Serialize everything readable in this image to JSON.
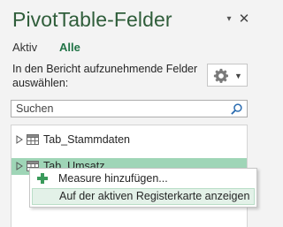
{
  "pane": {
    "title": "PivotTable-Felder",
    "dropdown_glyph": "▾",
    "close_glyph": "✕"
  },
  "tabs": [
    {
      "label": "Aktiv",
      "selected": false
    },
    {
      "label": "Alle",
      "selected": true
    }
  ],
  "instruction": "In den Bericht aufzunehmende Felder auswählen:",
  "tools": {
    "icon": "gear-icon",
    "caret": "▼"
  },
  "search": {
    "placeholder": "Suchen",
    "value": "",
    "icon": "search-icon"
  },
  "fields": [
    {
      "label": "Tab_Stammdaten",
      "icon": "table-icon",
      "expanded": false
    },
    {
      "label": "Tab_Umsatz",
      "icon": "table-icon",
      "expanded": false,
      "highlighted": true
    }
  ],
  "context_menu": {
    "items": [
      {
        "label": "Measure hinzufügen...",
        "icon": "plus-icon"
      },
      {
        "label": "Auf der aktiven Registerkarte anzeigen",
        "hovered": true
      }
    ]
  },
  "colors": {
    "title": "#2f5d3a",
    "accent": "#217346",
    "row_highlight": "#9fd5b7",
    "menu_hover": "#e3f1e8",
    "pane_bg": "#f3f3f3"
  }
}
